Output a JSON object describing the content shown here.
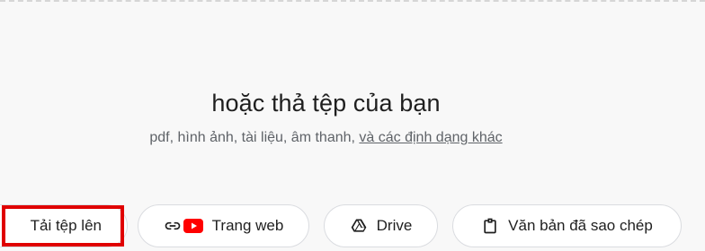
{
  "dropzone": {
    "headline": "hoặc thả tệp của bạn",
    "formats_text": "pdf, hình ảnh, tài liệu, âm thanh, ",
    "more_formats_link": "và các định dạng khác"
  },
  "sources": {
    "upload_label": "Tải tệp lên",
    "website_label": "Trang web",
    "drive_label": "Drive",
    "paste_label": "Văn bản đã sao chép"
  },
  "icons": {
    "website": [
      "link-icon",
      "youtube-icon"
    ],
    "drive": "drive-icon",
    "paste": "clipboard-icon"
  },
  "colors": {
    "highlight": "#e00000",
    "youtube": "#ff0000"
  }
}
